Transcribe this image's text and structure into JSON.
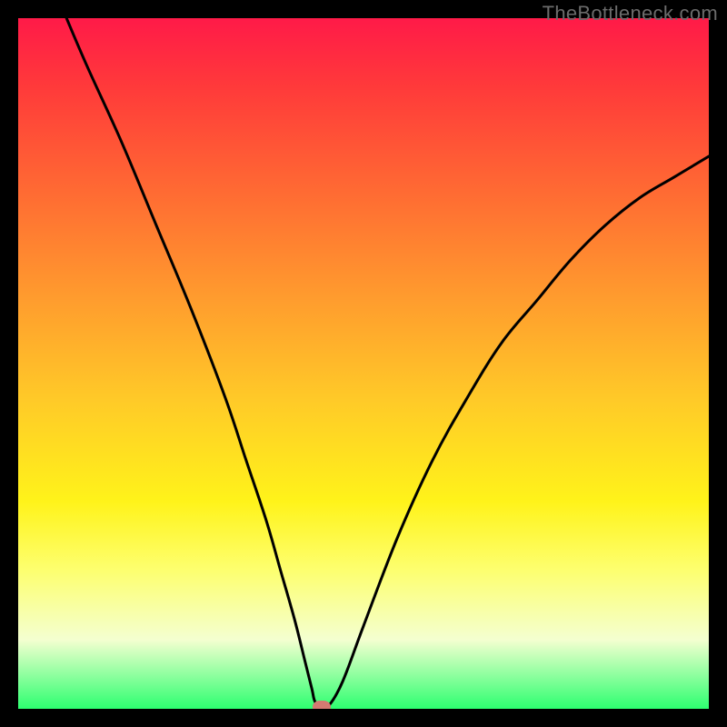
{
  "watermark": "TheBottleneck.com",
  "chart_data": {
    "type": "line",
    "title": "",
    "xlabel": "",
    "ylabel": "",
    "xlim": [
      0,
      100
    ],
    "ylim": [
      0,
      100
    ],
    "series": [
      {
        "name": "bottleneck-curve",
        "x": [
          7,
          10,
          15,
          20,
          25,
          30,
          33,
          36,
          38,
          40,
          41.5,
          42.5,
          43,
          44,
          45,
          47,
          50,
          55,
          60,
          65,
          70,
          75,
          80,
          85,
          90,
          95,
          100
        ],
        "y": [
          100,
          93,
          82,
          70,
          58,
          45,
          36,
          27,
          20,
          13,
          7,
          3,
          1,
          0.5,
          0.5,
          4,
          12,
          25,
          36,
          45,
          53,
          59,
          65,
          70,
          74,
          77,
          80
        ]
      }
    ],
    "marker": {
      "x": 44,
      "y": 0.3,
      "color": "#d37a72",
      "name": "optimal-point"
    },
    "gradient_bands": [
      {
        "pos": 0,
        "color": "#ff1a48"
      },
      {
        "pos": 10,
        "color": "#ff3a3a"
      },
      {
        "pos": 25,
        "color": "#ff6a33"
      },
      {
        "pos": 40,
        "color": "#ff9a2e"
      },
      {
        "pos": 55,
        "color": "#ffc928"
      },
      {
        "pos": 70,
        "color": "#fff31a"
      },
      {
        "pos": 80,
        "color": "#fdff70"
      },
      {
        "pos": 90,
        "color": "#f4ffd0"
      },
      {
        "pos": 100,
        "color": "#2dff70"
      }
    ]
  }
}
